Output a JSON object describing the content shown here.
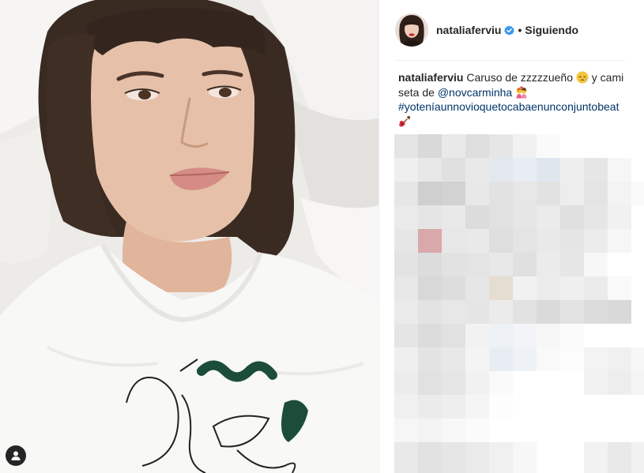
{
  "post": {
    "author": {
      "username": "nataliaferviu",
      "verified": true,
      "follow_status": "Siguiendo",
      "separator": "•"
    },
    "caption": {
      "username": "nataliaferviu",
      "text_1": " Caruso de zzzzzueño ",
      "emoji_1": "sleepy-face-emoji",
      "text_2": " y camiseta de ",
      "mention": "@novcarminha",
      "emoji_2": "kissing-couple-emoji",
      "hashtag": "#yoteníaunnovioquetocabaenunconjuntobeat",
      "emoji_3": "guitar-emoji"
    },
    "photo": {
      "description_icon": "user-tag-icon"
    },
    "comments": {
      "state": "pixelated"
    }
  },
  "colors": {
    "text": "#262626",
    "link": "#003569",
    "verified_badge": "#3897f0",
    "divider": "#efefef"
  }
}
